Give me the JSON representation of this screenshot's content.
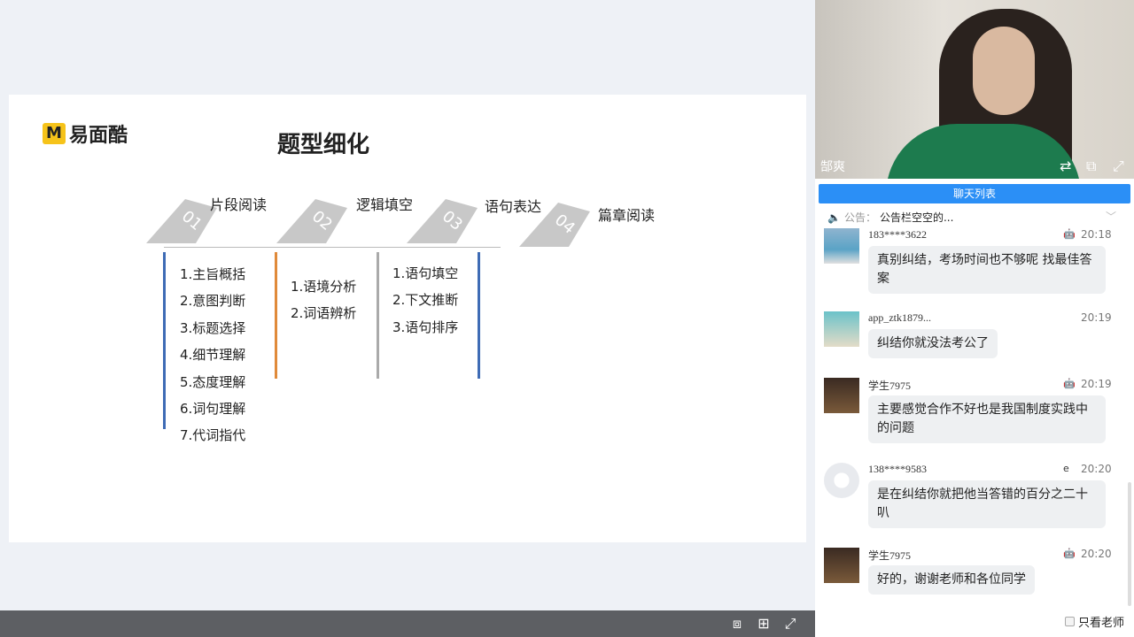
{
  "slide": {
    "logo_letter": "M",
    "logo_text": "易面酷",
    "title": "题型细化",
    "sections": [
      {
        "num": "01",
        "label": "片段阅读"
      },
      {
        "num": "02",
        "label": "逻辑填空"
      },
      {
        "num": "03",
        "label": "语句表达"
      },
      {
        "num": "04",
        "label": "篇章阅读"
      }
    ],
    "lists": [
      [
        "1.主旨概括",
        "2.意图判断",
        "3.标题选择",
        "4.细节理解",
        "5.态度理解",
        "6.词句理解",
        "7.代词指代"
      ],
      [
        "1.语境分析",
        "2.词语辨析"
      ],
      [
        "1.语句填空",
        "2.下文推断",
        "3.语句排序"
      ]
    ],
    "bar_colors": [
      "#3e6bb5",
      "#e08a3a",
      "#aaaaaa",
      "#3e6bb5"
    ]
  },
  "video": {
    "teacher_name": "郜爽"
  },
  "chat": {
    "list_button": "聊天列表",
    "notice_label": "公告：",
    "notice_text": "公告栏空空的...",
    "messages": [
      {
        "user": "183****3622",
        "device": "android-icon",
        "time": "20:18",
        "text": "真别纠结，考场时间也不够呢 找最佳答案"
      },
      {
        "user": "app_ztk1879...",
        "device": "apple-icon",
        "time": "20:19",
        "text": "纠结你就没法考公了"
      },
      {
        "user": "学生7975",
        "device": "android-icon",
        "time": "20:19",
        "text": "主要感觉合作不好也是我国制度实践中的问题"
      },
      {
        "user": "138****9583",
        "device": "ie-icon",
        "time": "20:20",
        "text": "是在纠结你就把他当答错的百分之二十叭"
      },
      {
        "user": "学生7975",
        "device": "android-icon",
        "time": "20:20",
        "text": "好的，谢谢老师和各位同学"
      }
    ],
    "only_teacher": "只看老师"
  }
}
